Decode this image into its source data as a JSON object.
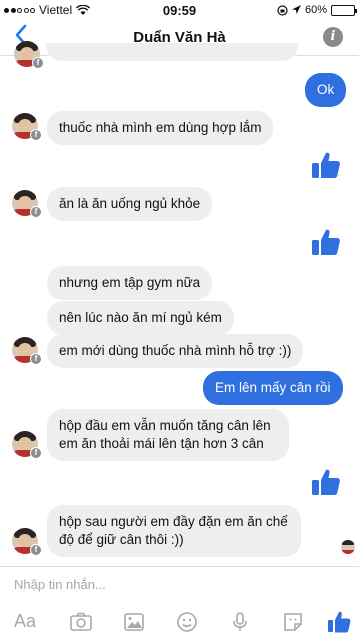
{
  "status_bar": {
    "carrier": "Viettel",
    "time": "09:59",
    "battery": "60%",
    "battery_level": 0.6
  },
  "header": {
    "title": "Duẩn Văn Hà",
    "back_icon": "chevron-left-icon",
    "info_icon": "info-icon"
  },
  "messages": [
    {
      "side": "out",
      "text": "Ok"
    },
    {
      "side": "in",
      "text": "thuốc nhà mình em dùng hợp lắm"
    },
    {
      "side": "out",
      "type": "like"
    },
    {
      "side": "in",
      "text": "ăn là ăn uống ngủ khỏe"
    },
    {
      "side": "out",
      "type": "like"
    },
    {
      "side": "in",
      "text": "nhưng em tập gym nữa"
    },
    {
      "side": "in",
      "text": "nên lúc nào ăn mí ngủ kém"
    },
    {
      "side": "in",
      "text": "em mới dùng thuốc nhà mình hỗ trợ :))"
    },
    {
      "side": "out",
      "text": "Em lên mấy cân rồi"
    },
    {
      "side": "in",
      "text": "hộp đầu em vẫn muốn tăng cân lên em ăn thoải mái lên tận hơn 3 cân",
      "lines": [
        "hộp đầu em vẫn muốn tăng cân lên",
        "em ăn thoải mái lên tận hơn 3 cân"
      ]
    },
    {
      "side": "out",
      "type": "like"
    },
    {
      "side": "in",
      "text": "hộp sau người em đầy đặn em ăn chế độ để giữ cân thôi :))",
      "lines": [
        "hộp sau người em đầy đặn em ăn chế",
        "độ để giữ cân thôi :))"
      ]
    }
  ],
  "composer": {
    "placeholder": "Nhập tin nhắn...",
    "text_icon_label": "Aa",
    "tools": [
      "text-format-icon",
      "camera-icon",
      "gallery-icon",
      "emoji-icon",
      "microphone-icon",
      "sticker-icon",
      "like-icon"
    ]
  },
  "colors": {
    "accent": "#1a7cf5",
    "outgoing_bubble": "#2f6fe0",
    "incoming_bubble": "#eeeeef"
  }
}
